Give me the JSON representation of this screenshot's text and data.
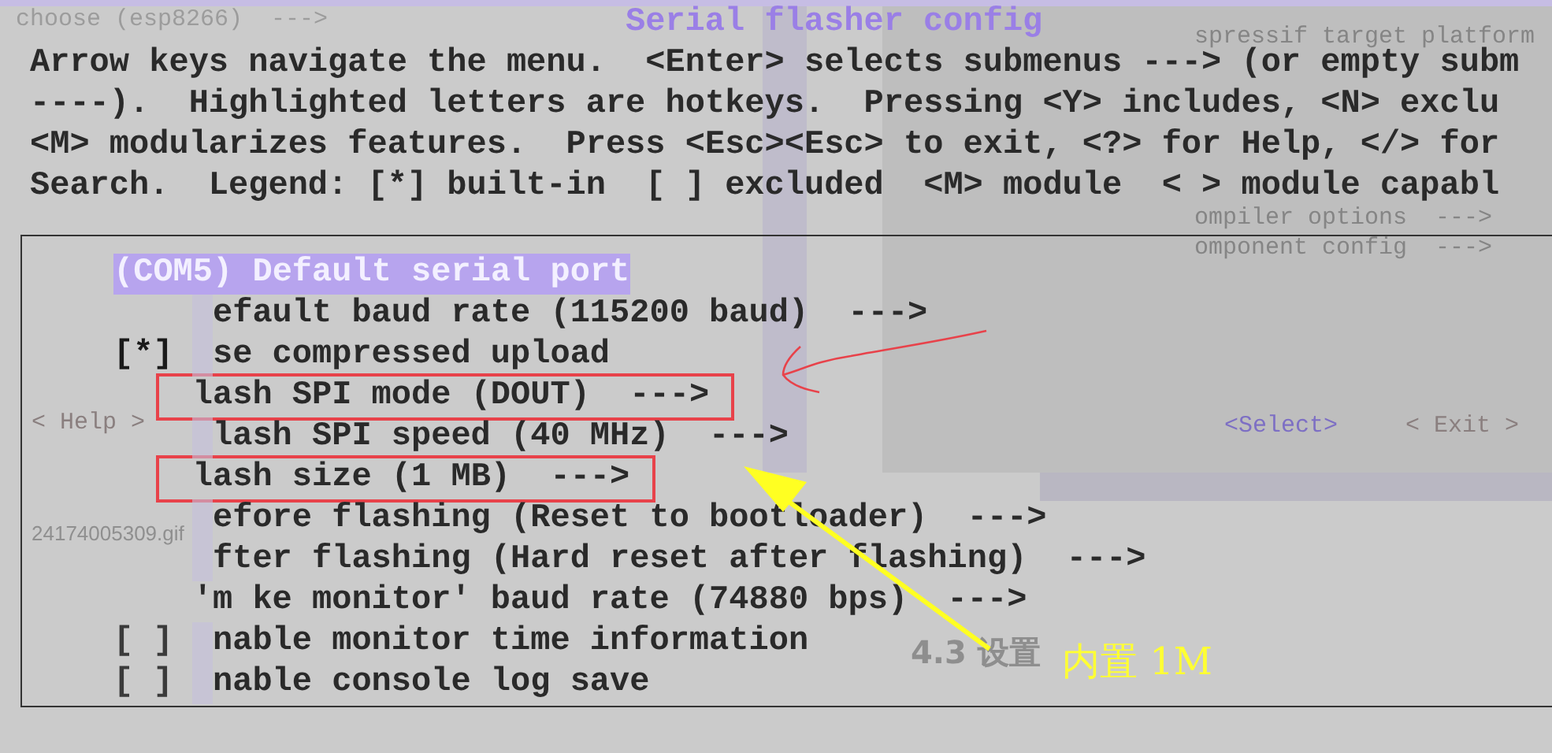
{
  "background_texts": [
    {
      "kind": "crumb",
      "text": "choose (esp8266)  --->"
    },
    {
      "kind": "title",
      "text": "Serial flasher config"
    },
    {
      "kind": "side1",
      "text": "spressif target platform"
    },
    {
      "kind": "side3",
      "text": "ompiler options  --->"
    },
    {
      "kind": "side4",
      "text": "omponent config  --->"
    },
    {
      "kind": "help",
      "text": "< Help >"
    },
    {
      "kind": "select",
      "text": "<Select>"
    },
    {
      "kind": "exit",
      "text": "< Exit >"
    },
    {
      "kind": "file",
      "text": "24174005309.gif"
    },
    {
      "kind": "heading",
      "text": "4.3 设置"
    }
  ],
  "help_lines": [
    "Arrow keys navigate the menu.  <Enter> selects submenus ---> (or empty subm",
    "----).  Highlighted letters are hotkeys.  Pressing <Y> includes, <N> exclu",
    "<M> modularizes features.  Press <Esc><Esc> to exit, <?> for Help, </> for",
    "Search.  Legend: [*] built-in  [ ] excluded  <M> module  < > module capabl"
  ],
  "menu": [
    {
      "kind": "full",
      "text": "(COM5) Default serial port",
      "selected": true,
      "boxed": false
    },
    {
      "kind": "plain",
      "text": "efault baud rate (115200 baud)  --->",
      "selected": false,
      "boxed": false
    },
    {
      "kind": "plain",
      "prefix": "[*]",
      "checked": true,
      "text": "se compressed upload",
      "selected": false,
      "boxed": false
    },
    {
      "kind": "plain",
      "text": "lash SPI mode (DOUT)  --->",
      "selected": false,
      "boxed": true
    },
    {
      "kind": "plain",
      "text": "lash SPI speed (40 MHz)  --->",
      "selected": false,
      "boxed": false
    },
    {
      "kind": "plain",
      "text": "lash size (1 MB)  --->",
      "selected": false,
      "boxed": true
    },
    {
      "kind": "plain",
      "text": "efore flashing (Reset to bootloader)  --->",
      "selected": false,
      "boxed": false
    },
    {
      "kind": "plain",
      "text": "fter flashing (Hard reset after flashing)  --->",
      "selected": false,
      "boxed": false
    },
    {
      "kind": "quoted",
      "text": "'m ke monitor' baud rate (74880 bps)  --->",
      "selected": false,
      "boxed": false
    },
    {
      "kind": "plain",
      "prefix": "[ ]",
      "checked": false,
      "text": "nable monitor time information",
      "selected": false,
      "boxed": false
    },
    {
      "kind": "plain",
      "prefix": "[ ]",
      "checked": false,
      "text": "nable console log save",
      "selected": false,
      "boxed": false
    }
  ],
  "annotation": {
    "text": "内置 1M"
  }
}
